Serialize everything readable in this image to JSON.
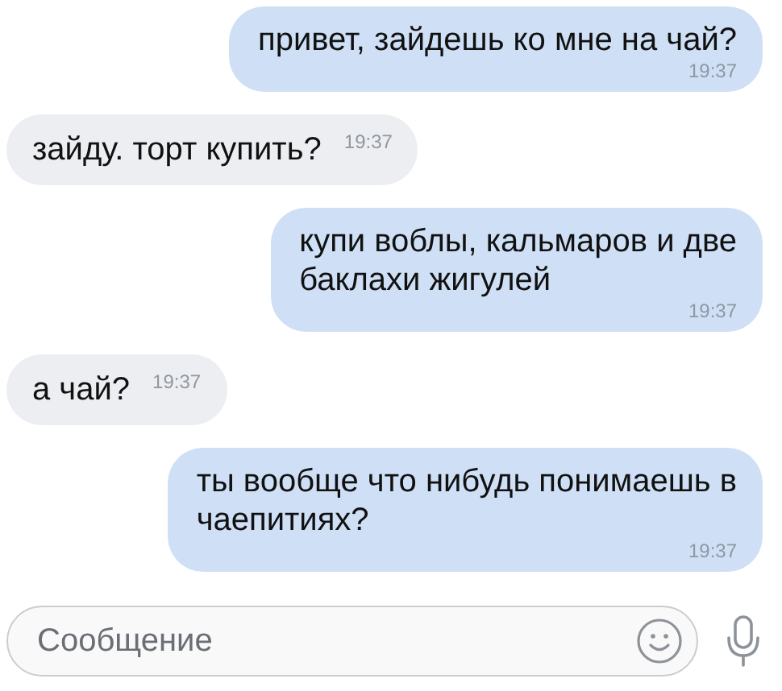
{
  "messages": [
    {
      "kind": "outgoing",
      "text": "привет, зайдешь ко мне на чай?",
      "time": "19:37"
    },
    {
      "kind": "incoming",
      "text": "зайду. торт купить?",
      "time": "19:37"
    },
    {
      "kind": "outgoing",
      "text": "купи воблы, кальмаров и две\nбаклахи жигулей",
      "time": "19:37"
    },
    {
      "kind": "incoming",
      "text": "а чай?",
      "time": "19:37"
    },
    {
      "kind": "outgoing",
      "text": "ты вообще что нибудь понимаешь в\nчаепитиях?",
      "time": "19:37"
    }
  ],
  "composer": {
    "placeholder": "Сообщение"
  }
}
